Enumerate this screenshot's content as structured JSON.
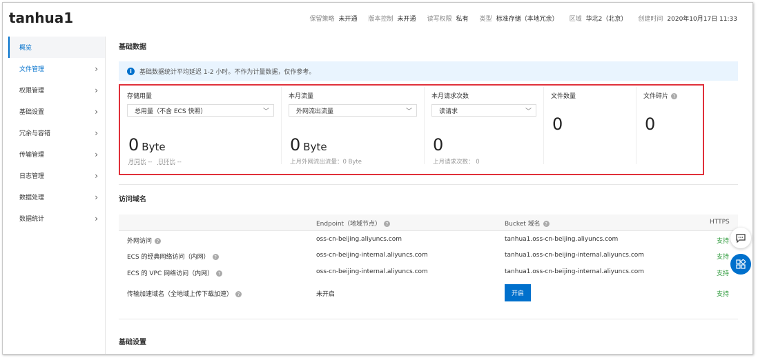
{
  "header": {
    "title": "tanhua1",
    "meta": [
      {
        "k": "保留策略",
        "v": "未开通"
      },
      {
        "k": "版本控制",
        "v": "未开通"
      },
      {
        "k": "读写权限",
        "v": "私有"
      },
      {
        "k": "类型",
        "v": "标准存储（本地冗余）"
      },
      {
        "k": "区域",
        "v": "华北2（北京）"
      },
      {
        "k": "创建时间",
        "v": "2020年10月17日 11:33"
      }
    ]
  },
  "sidebar": {
    "items": [
      {
        "label": "概览"
      },
      {
        "label": "文件管理"
      },
      {
        "label": "权限管理"
      },
      {
        "label": "基础设置"
      },
      {
        "label": "冗余与容错"
      },
      {
        "label": "传输管理"
      },
      {
        "label": "日志管理"
      },
      {
        "label": "数据处理"
      },
      {
        "label": "数据统计"
      }
    ]
  },
  "basic": {
    "title": "基础数据",
    "notice": "基础数据统计平均延迟 1-2 小时。不作为计量数据，仅作参考。",
    "storage": {
      "label": "存储用量",
      "select": "总用量（不含 ECS 快照）",
      "value": "0",
      "unit": "Byte",
      "mom": "月同比",
      "mom_v": "--",
      "dod": "日环比",
      "dod_v": "--"
    },
    "traffic": {
      "label": "本月流量",
      "select": "外网流出流量",
      "value": "0",
      "unit": "Byte",
      "sub": "上月外网流出流量：0 Byte"
    },
    "requests": {
      "label": "本月请求次数",
      "select": "读请求",
      "value": "0",
      "sub": "上月请求次数： 0"
    },
    "files": {
      "label": "文件数量",
      "value": "0"
    },
    "fragments": {
      "label": "文件碎片",
      "value": "0"
    }
  },
  "domains": {
    "title": "访问域名",
    "headers": {
      "endpoint": "Endpoint（地域节点）",
      "bucket": "Bucket 域名",
      "https": "HTTPS"
    },
    "rows": [
      {
        "label": "外网访问",
        "endpoint": "oss-cn-beijing.aliyuncs.com",
        "bucket": "tanhua1.oss-cn-beijing.aliyuncs.com",
        "https": "支持"
      },
      {
        "label": "ECS 的经典网络访问（内网）",
        "endpoint": "oss-cn-beijing-internal.aliyuncs.com",
        "bucket": "tanhua1.oss-cn-beijing-internal.aliyuncs.com",
        "https": "支持"
      },
      {
        "label": "ECS 的 VPC 网络访问（内网）",
        "endpoint": "oss-cn-beijing-internal.aliyuncs.com",
        "bucket": "tanhua1.oss-cn-beijing-internal.aliyuncs.com",
        "https": "支持"
      },
      {
        "label": "传输加速域名（全地域上传下载加速）",
        "endpoint": "未开启",
        "button": "开启",
        "https": "支持"
      }
    ]
  },
  "settings": {
    "title": "基础设置"
  }
}
